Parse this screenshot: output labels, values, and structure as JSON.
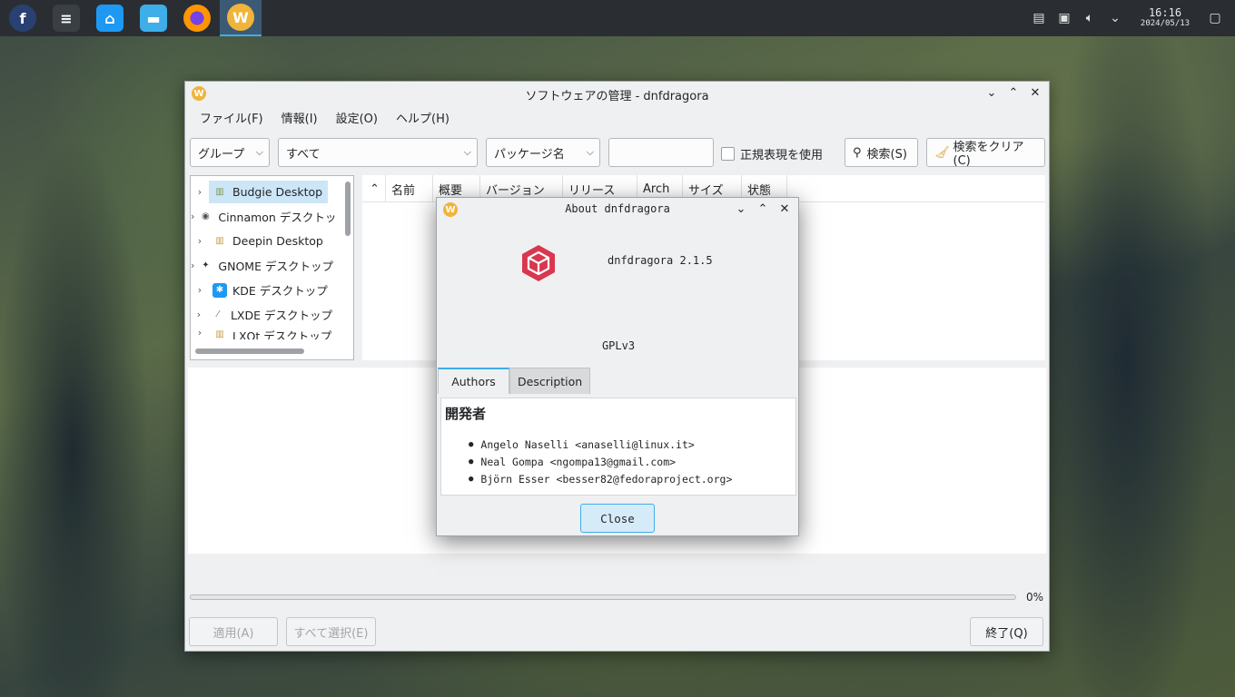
{
  "taskbar": {
    "apps": [
      {
        "name": "fedora-menu-icon",
        "glyph": "f",
        "color": "#294172"
      },
      {
        "name": "system-settings-icon",
        "glyph": "≡",
        "color": "#3a3f44"
      },
      {
        "name": "software-store-icon",
        "glyph": "⌂",
        "color": "#1d99f3"
      },
      {
        "name": "file-manager-icon",
        "glyph": "▬",
        "color": "#3daee9"
      },
      {
        "name": "firefox-icon",
        "glyph": "●",
        "color": "#e66000"
      },
      {
        "name": "dnfdragora-icon",
        "glyph": "W",
        "color": "#f0b43a"
      }
    ],
    "clock_time": "16:16",
    "clock_date": "2024/05/13"
  },
  "window": {
    "title": "ソフトウェアの管理 - dnfdragora",
    "menu": [
      "ファイル(F)",
      "情報(I)",
      "設定(O)",
      "ヘルプ(H)"
    ],
    "toolbar": {
      "group_combo": "グループ",
      "filter_combo": "すべて",
      "field_combo": "パッケージ名",
      "search_value": "",
      "regex_label": "正規表現を使用",
      "search_button": "検索(S)",
      "clear_button": "検索をクリア(C)"
    },
    "groups": [
      {
        "label": "Budgie Desktop",
        "icon": "▥",
        "color": "#7a9a58"
      },
      {
        "label": "Cinnamon デスクトップ",
        "icon": "◉",
        "color": "#555"
      },
      {
        "label": "Deepin Desktop",
        "icon": "▥",
        "color": "#c4a24a"
      },
      {
        "label": "GNOME デスクトップ",
        "icon": "✦",
        "color": "#333"
      },
      {
        "label": "KDE デスクトップ",
        "icon": "✱",
        "color": "#1d99f3"
      },
      {
        "label": "LXDE デスクトップ",
        "icon": "⁄",
        "color": "#777"
      },
      {
        "label": "LXQt デスクトップ",
        "icon": "▥",
        "color": "#c4a24a"
      }
    ],
    "columns": [
      "名前",
      "概要",
      "バージョン",
      "リリース",
      "Arch",
      "サイズ",
      "状態"
    ],
    "progress_label": "0%",
    "progress": 0,
    "apply_button": "適用(A)",
    "select_all_button": "すべて選択(E)",
    "quit_button": "終了(Q)"
  },
  "about": {
    "title": "About dnfdragora",
    "version_text": "dnfdragora 2.1.5",
    "license": "GPLv3",
    "tabs": [
      "Authors",
      "Description"
    ],
    "heading": "開発者",
    "authors": [
      "Angelo Naselli <anaselli@linux.it>",
      "Neal Gompa <ngompa13@gmail.com>",
      "Björn Esser <besser82@fedoraproject.org>"
    ],
    "close_button": "Close",
    "logo_color": "#e0445c"
  }
}
